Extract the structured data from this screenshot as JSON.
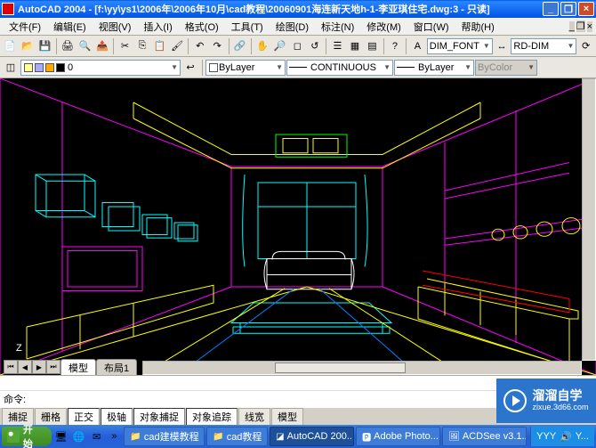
{
  "titlebar": {
    "app": "AutoCAD 2004",
    "file": "[f:\\yy\\ys1\\2006年\\2006年10月\\cad教程\\20060901海连新天地h-1-李亚琪住宅.dwg:3 - 只读]"
  },
  "menubar": {
    "items": [
      "文件(F)",
      "编辑(E)",
      "视图(V)",
      "插入(I)",
      "格式(O)",
      "工具(T)",
      "绘图(D)",
      "标注(N)",
      "修改(M)",
      "窗口(W)",
      "帮助(H)"
    ]
  },
  "toolbar1": {
    "font_combo": "DIM_FONT",
    "dim_combo": "RD-DIM"
  },
  "toolbar2": {
    "layer_swatches": [
      "#fff",
      "#888",
      "#fff",
      "#000"
    ],
    "layer_combo": "ByLayer",
    "linetype_combo": "CONTINUOUS",
    "lineweight_combo": "ByLayer",
    "color_combo": "ByColor"
  },
  "model_tabs": {
    "tabs": [
      "模型",
      "布局1"
    ]
  },
  "cmdline": {
    "prompt": "命令:"
  },
  "statusbar": {
    "buttons": [
      "捕捉",
      "栅格",
      "正交",
      "极轴",
      "对象捕捉",
      "对象追踪",
      "线宽",
      "模型"
    ]
  },
  "taskbar": {
    "start": "开始",
    "tasks": [
      "cad建模教程",
      "cad教程",
      "AutoCAD 200...",
      "Adobe Photo...",
      "ACDSee v3.1..."
    ],
    "tray_text": "YYY",
    "tray_time": "Y..."
  },
  "watermark": {
    "line1": "溜溜自学",
    "line2": "zixue.3d66.com"
  },
  "ucs": {
    "z": "Z"
  }
}
